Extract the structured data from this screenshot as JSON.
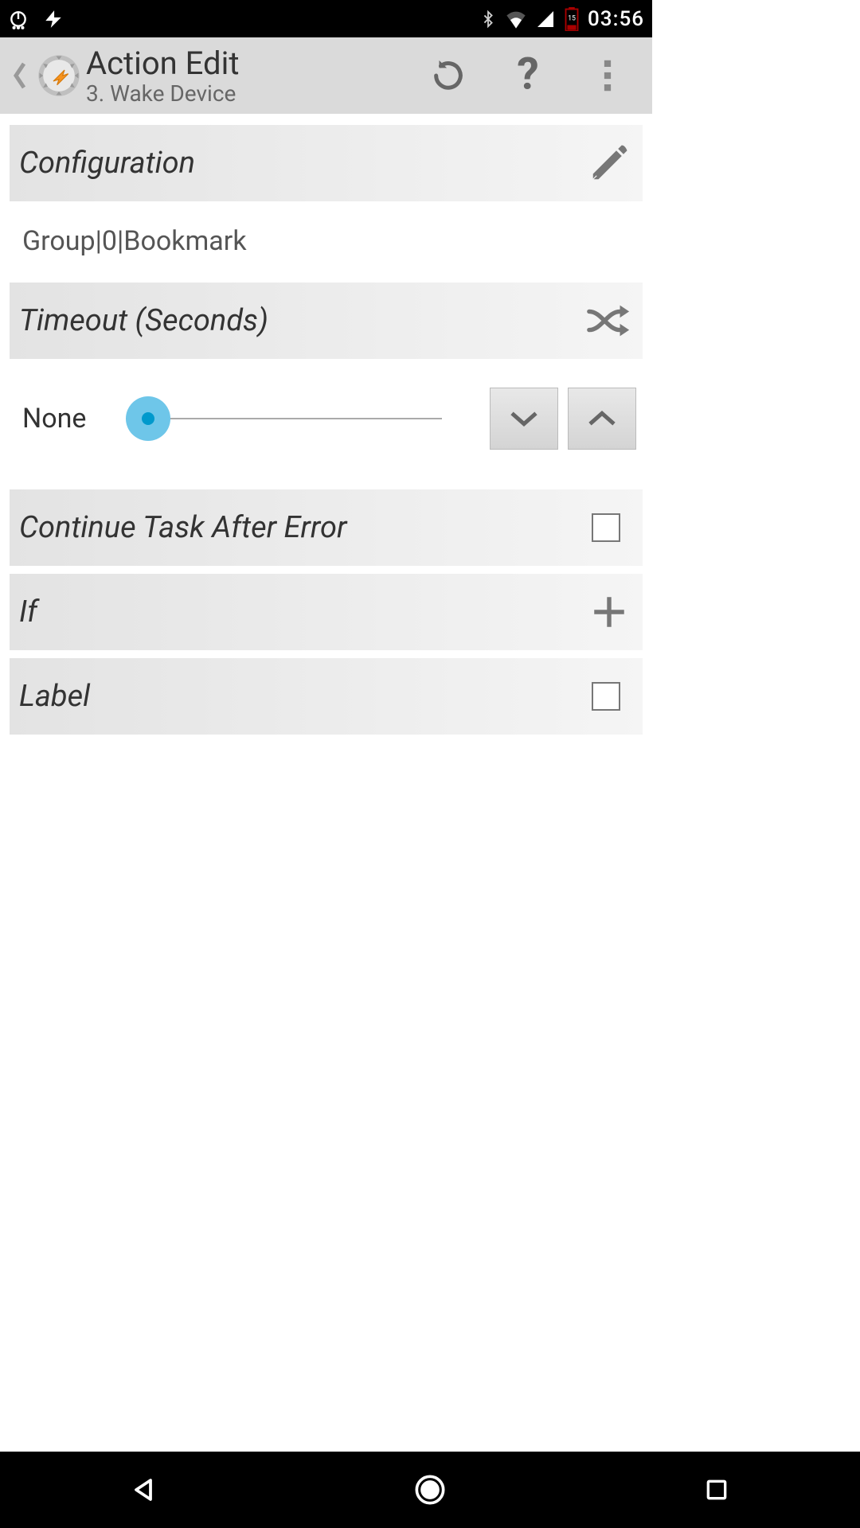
{
  "statusbar": {
    "time": "03:56",
    "battery_level": "15"
  },
  "appbar": {
    "title": "Action Edit",
    "subtitle": "3. Wake Device"
  },
  "sections": {
    "configuration": {
      "label": "Configuration",
      "value": "Group|0|Bookmark"
    },
    "timeout": {
      "label": "Timeout (Seconds)",
      "slider_value": "None"
    },
    "continue": {
      "label": "Continue Task After Error"
    },
    "if": {
      "label": "If"
    },
    "labelsec": {
      "label": "Label"
    }
  }
}
